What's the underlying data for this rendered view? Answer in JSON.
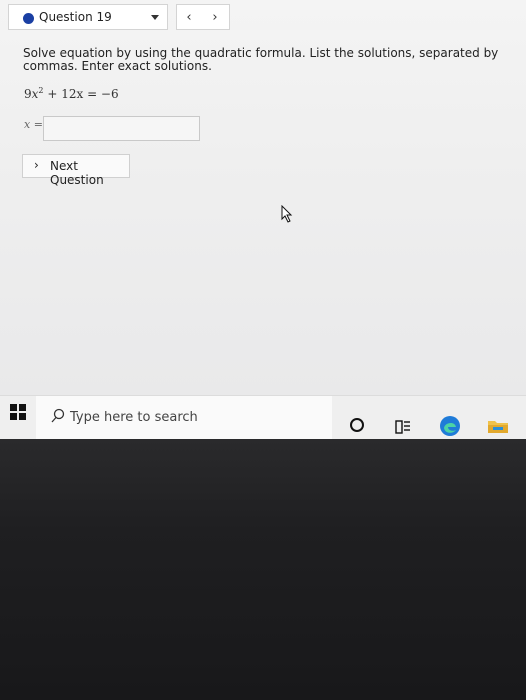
{
  "question_nav": {
    "label": "Question 19",
    "prev_icon": "‹",
    "next_icon": "›"
  },
  "problem": {
    "prompt": "Solve equation by using the quadratic formula. List the solutions, separated by commas. Enter exact solutions.",
    "equation": {
      "coef_a": "9",
      "var": "x",
      "exp": "2",
      "rest": "+ 12x = −6"
    },
    "answer_label": "x =",
    "answer_value": ""
  },
  "next_button": {
    "chevron": "›",
    "label": "Next Question"
  },
  "taskbar": {
    "search_placeholder": "Type here to search"
  },
  "colors": {
    "question_dot": "#1a3fa3",
    "edge_blue": "#1f7bd8",
    "folder_yellow": "#f0c24b"
  }
}
